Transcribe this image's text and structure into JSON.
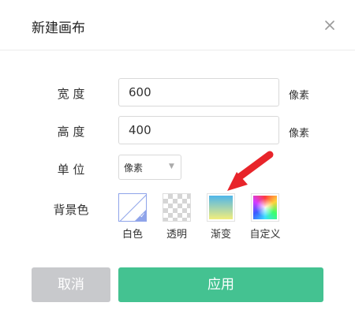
{
  "dialog": {
    "title": "新建画布",
    "close_icon": "close-icon"
  },
  "form": {
    "width": {
      "label": "宽 度",
      "value": "600",
      "unit": "像素"
    },
    "height": {
      "label": "高 度",
      "value": "400",
      "unit": "像素"
    },
    "unit_select": {
      "label": "单 位",
      "selected": "像素"
    },
    "background": {
      "label": "背景色",
      "options": [
        {
          "label": "白色",
          "selected": true
        },
        {
          "label": "透明",
          "selected": false
        },
        {
          "label": "渐变",
          "selected": false
        },
        {
          "label": "自定义",
          "selected": false
        }
      ]
    }
  },
  "annotation": {
    "arrow_color": "#e8242a"
  },
  "buttons": {
    "cancel": "取消",
    "apply": "应用"
  },
  "colors": {
    "accent": "#44c291",
    "selected_border": "#8fa4ea",
    "cancel": "#c8c9cc"
  }
}
